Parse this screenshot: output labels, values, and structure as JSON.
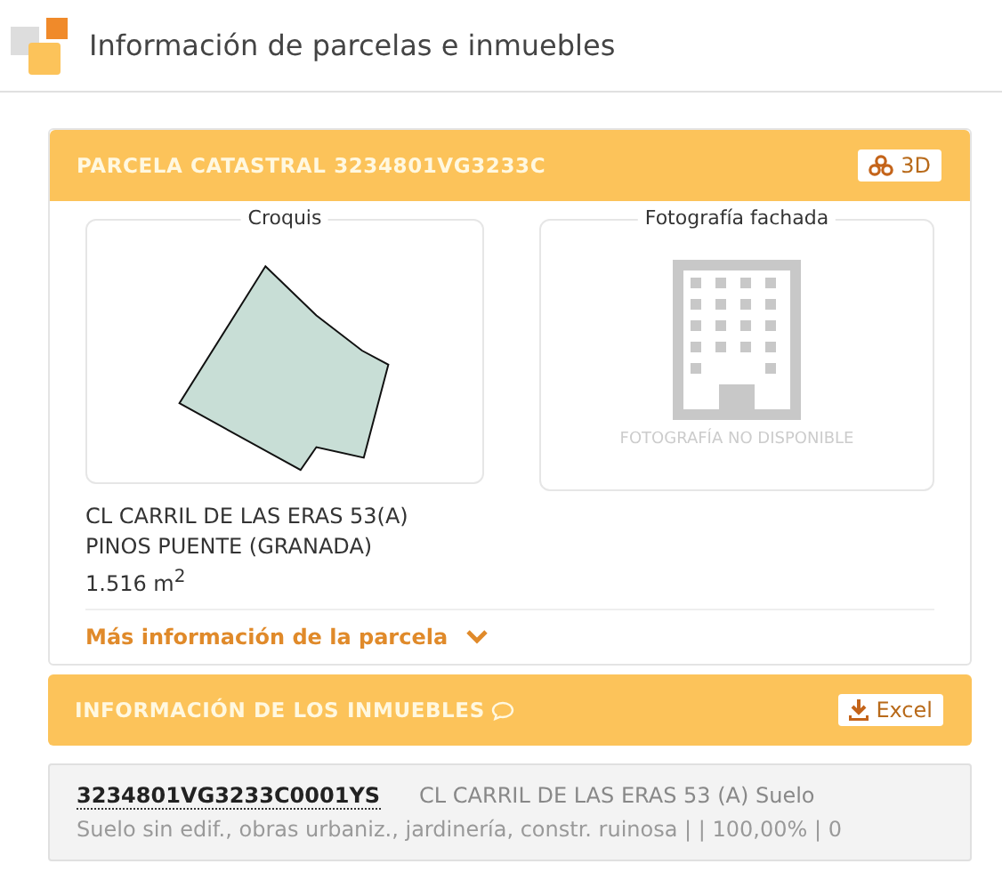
{
  "page": {
    "title": "Información de parcelas e inmuebles"
  },
  "parcel": {
    "title": "PARCELA CATASTRAL 3234801VG3233C",
    "button_3d": "3D",
    "sketch_label": "Croquis",
    "photo_label": "Fotografía fachada",
    "photo_placeholder": "FOTOGRAFÍA NO DISPONIBLE",
    "address_lines": [
      "CL CARRIL DE LAS ERAS 53(A)",
      "PINOS PUENTE (GRANADA)",
      "1.516 m$^{2}$"
    ],
    "more_link": "Más información de la parcela",
    "expanded": false
  },
  "properties": {
    "title": "INFORMACIÓN DE LOS INMUEBLES",
    "excel_button": "Excel",
    "items": [
      {
        "reference": "3234801VG3233C0001YS",
        "address": "CL CARRIL DE LAS ERAS 53 (A) Suelo",
        "details": "Suelo sin edif., obras urbaniz., jardinería, constr. ruinosa | | 100,00% | 0"
      }
    ]
  }
}
